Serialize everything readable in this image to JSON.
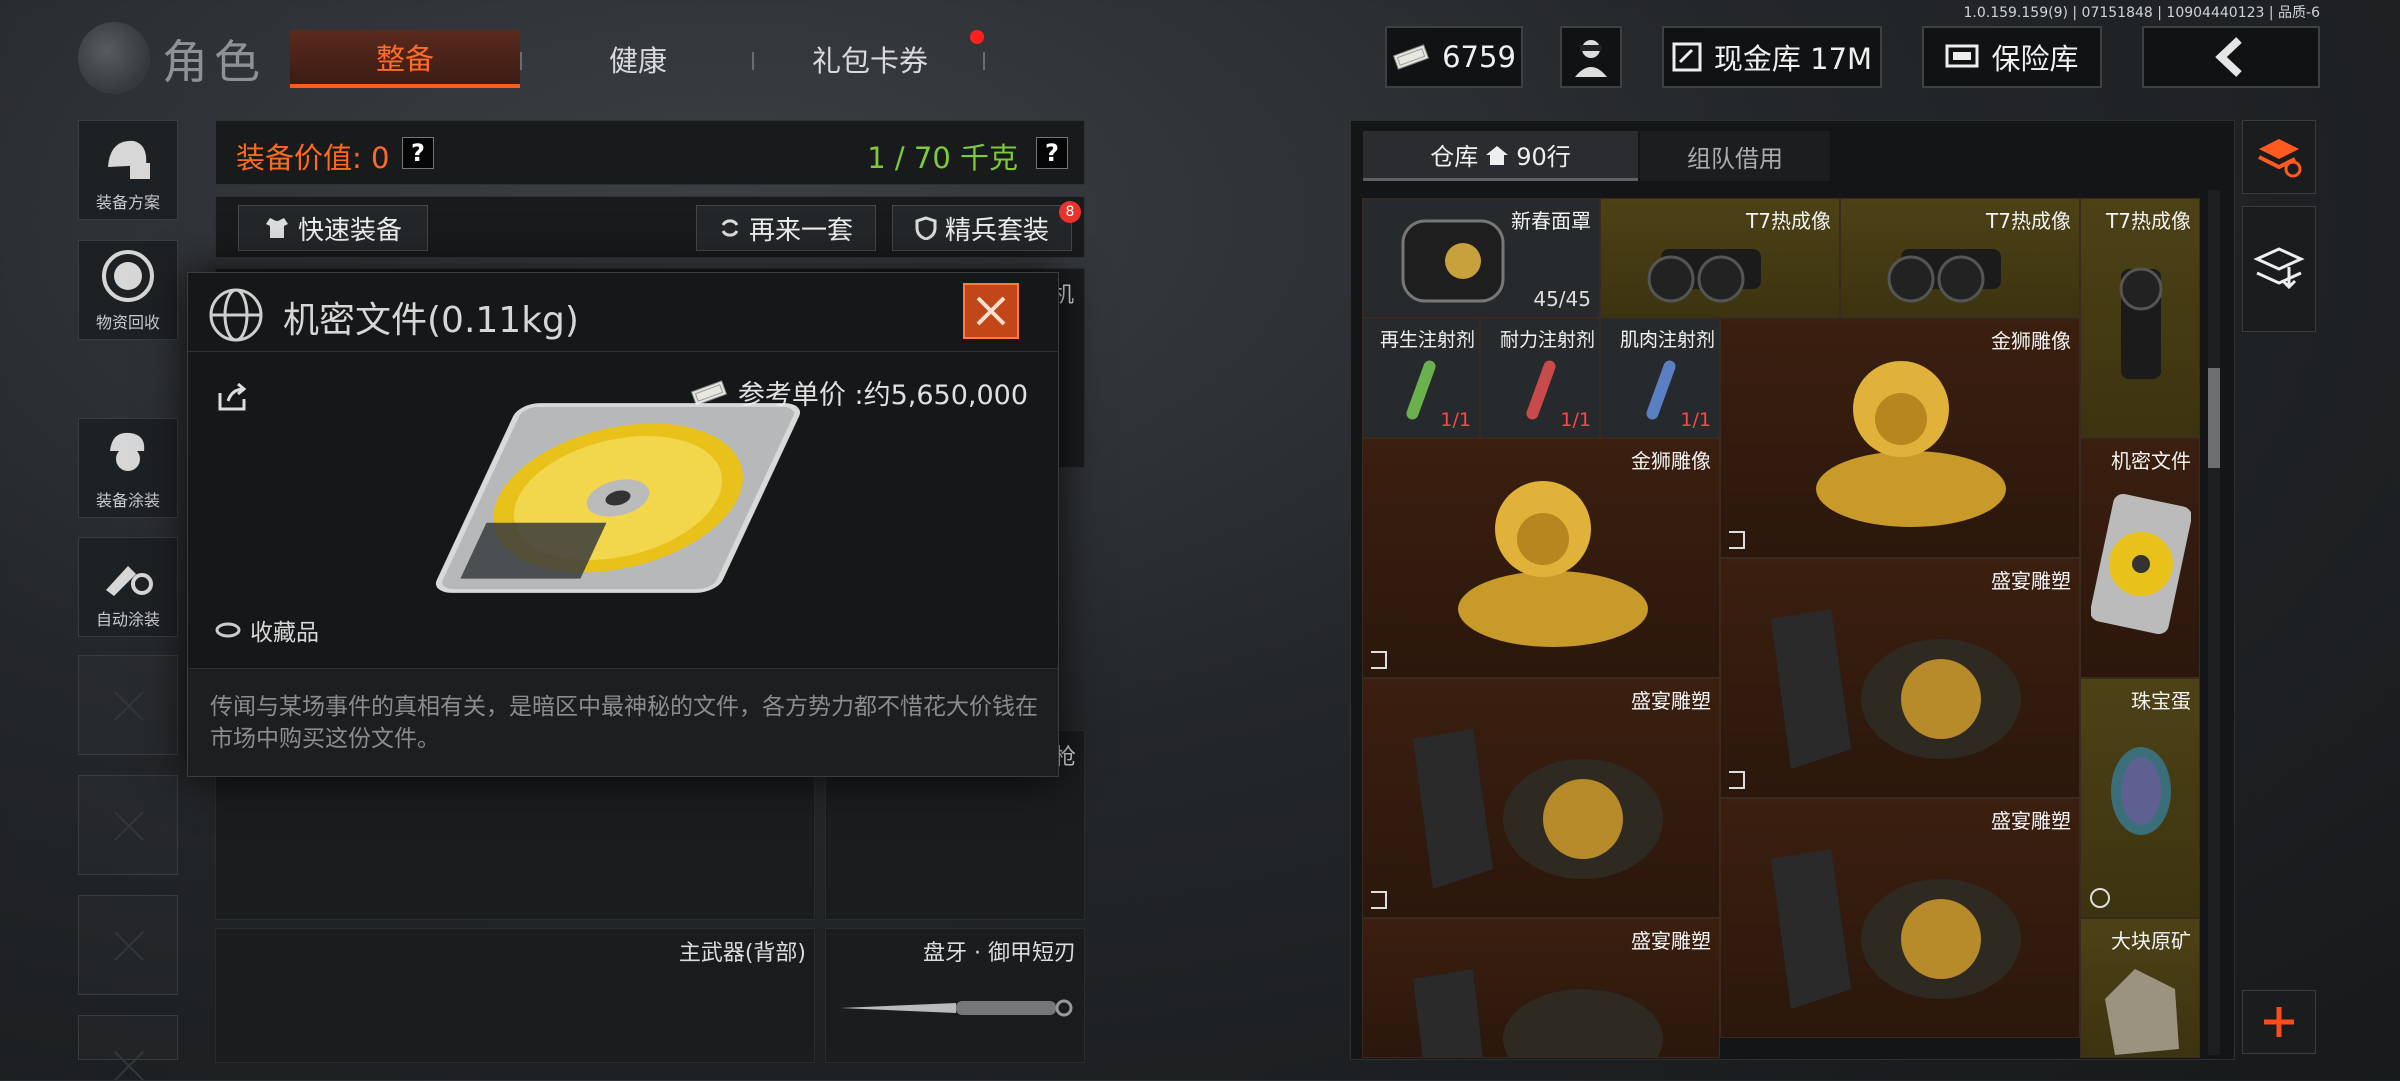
{
  "version_text": "1.0.159.159(9) | 07151848 | 10904440123 | 品质-6",
  "header": {
    "title": "角色",
    "tabs": [
      {
        "label": "整备",
        "active": true
      },
      {
        "label": "健康",
        "active": false
      },
      {
        "label": "礼包卡券",
        "active": false,
        "has_notification": true
      }
    ],
    "currency_value": "6759",
    "cash_vault_label": "现金库 17M",
    "safe_label": "保险库",
    "accent_color": "#ff5a1f"
  },
  "left_sidebar": [
    {
      "label": "装备方案",
      "icon": "helmet-plan-icon"
    },
    {
      "label": "物资回收",
      "icon": "recycle-icon"
    },
    {
      "label": "装备涂装",
      "icon": "soldier-paint-icon"
    },
    {
      "label": "自动涂装",
      "icon": "brush-gear-icon"
    }
  ],
  "equipment": {
    "value_label": "装备价值: 0",
    "weight_label": "1 / 70 千克",
    "help": "?",
    "quick_equip": "快速装备",
    "again": "再来一套",
    "elite_set": "精兵套装",
    "elite_badge": "8",
    "slot_labels": {
      "partial_top": "机",
      "partial_mid": "枪",
      "primary_back": "主武器(背部)",
      "melee": "盘牙 · 御甲短刃"
    }
  },
  "item_popup": {
    "title": "机密文件(0.11kg)",
    "ref_price": "参考单价 :约5,650,000",
    "tag": "收藏品",
    "description": "传闻与某场事件的真相有关，是暗区中最神秘的文件，各方势力都不惜花大价钱在市场中购买这份文件。"
  },
  "warehouse": {
    "tab_storage": "仓库",
    "rows_label": "90行",
    "tab_team": "组队借用",
    "items": [
      {
        "name": "新春面罩",
        "count": "45/45",
        "bg": "dark"
      },
      {
        "name": "T7热成像",
        "bg": "gold"
      },
      {
        "name": "T7热成像",
        "bg": "gold"
      },
      {
        "name": "T7热成像",
        "bg": "gold"
      },
      {
        "name": "再生注射剂",
        "count": "1/1",
        "bg": "dark"
      },
      {
        "name": "耐力注射剂",
        "count": "1/1",
        "bg": "dark"
      },
      {
        "name": "肌肉注射剂",
        "count": "1/1",
        "bg": "dark"
      },
      {
        "name": "金狮雕像",
        "bg": "brown"
      },
      {
        "name": "金狮雕像",
        "bg": "brown"
      },
      {
        "name": "机密文件",
        "bg": "brown"
      },
      {
        "name": "盛宴雕塑",
        "bg": "brown"
      },
      {
        "name": "盛宴雕塑",
        "bg": "brown"
      },
      {
        "name": "珠宝蛋",
        "bg": "gold"
      },
      {
        "name": "盛宴雕塑",
        "bg": "brown"
      },
      {
        "name": "盛宴雕塑",
        "bg": "brown"
      },
      {
        "name": "大块原矿",
        "bg": "gold"
      }
    ]
  }
}
